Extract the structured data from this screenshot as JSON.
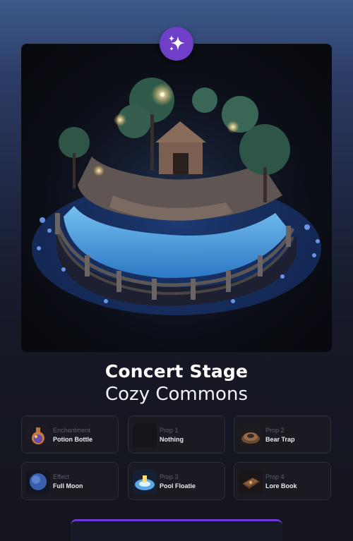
{
  "title": "Concert Stage",
  "subtitle": "Cozy Commons",
  "badge_icon": "sparkles-icon",
  "scene_icon": "island-stage-diorama",
  "accent": "#6f3fc7",
  "slots": [
    {
      "category": "Enchantment",
      "value": "Potion Bottle",
      "icon": "potion-bottle-icon"
    },
    {
      "category": "Prop 1",
      "value": "Nothing",
      "icon": "empty-slot-icon"
    },
    {
      "category": "Prop 2",
      "value": "Bear Trap",
      "icon": "bear-trap-icon"
    },
    {
      "category": "Effect",
      "value": "Full Moon",
      "icon": "full-moon-icon"
    },
    {
      "category": "Prop 3",
      "value": "Pool Floatie",
      "icon": "pool-floatie-icon"
    },
    {
      "category": "Prop 4",
      "value": "Lore Book",
      "icon": "lore-book-icon"
    }
  ]
}
